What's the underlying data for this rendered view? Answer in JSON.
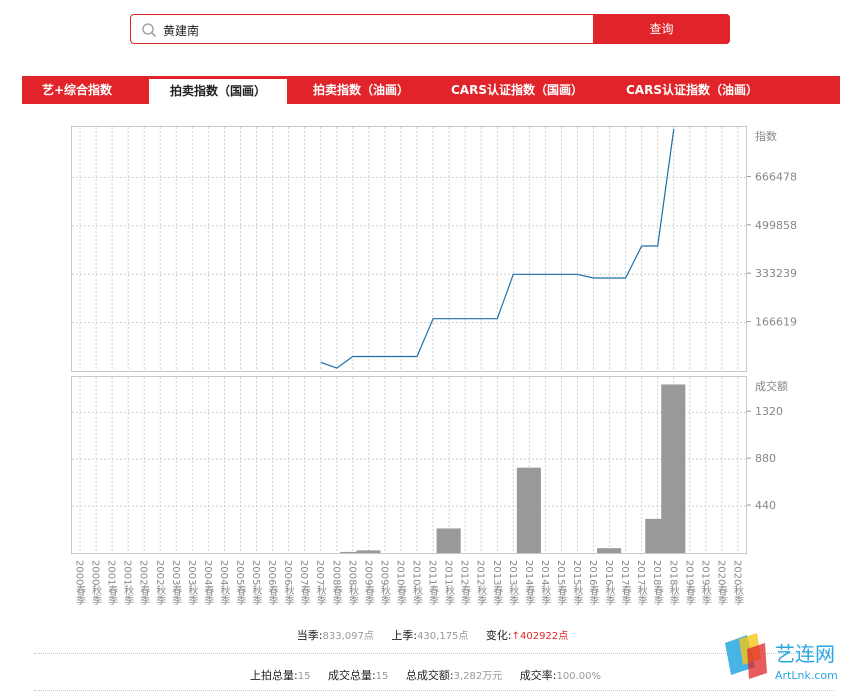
{
  "search": {
    "value": "黄建南",
    "button_label": "查询"
  },
  "tabs": [
    {
      "label": "艺+综合指数",
      "active": false
    },
    {
      "label": "拍卖指数（国画）",
      "active": true
    },
    {
      "label": "拍卖指数（油画）",
      "active": false
    },
    {
      "label": "CARS认证指数（国画）",
      "active": false
    },
    {
      "label": "CARS认证指数（油画）",
      "active": false
    }
  ],
  "chart_data": [
    {
      "type": "line",
      "ylabel": "指数",
      "yticks": [
        166619,
        333239,
        499858,
        666478
      ],
      "ylim": [
        0,
        840000
      ],
      "x": [
        "2000春季",
        "2000秋季",
        "2001秋季",
        "2002秋季",
        "2002春季",
        "2003春季",
        "2004春季",
        "2004秋季",
        "2005春季",
        "2006秋季",
        "2006春季",
        "2007秋季",
        "2008春季",
        "2008秋季",
        "2009秋季",
        "2009春季",
        "2010秋季",
        "2010春季",
        "2011秋季",
        "2012春季",
        "2012秋季",
        "2013春季",
        "2013秋季",
        "2014春季",
        "2015春季",
        "2015秋季",
        "2016秋季",
        "2017秋季",
        "2017春季",
        "2018秋季",
        "2018春季",
        "2019春季",
        "2019秋季",
        "2020春季",
        "2020秋季"
      ],
      "series": [
        {
          "color": "#1e6fa8",
          "values": [
            null,
            null,
            null,
            null,
            null,
            null,
            null,
            null,
            null,
            null,
            null,
            null,
            null,
            null,
            null,
            30000,
            10000,
            50000,
            50000,
            50000,
            50000,
            50000,
            180000,
            180000,
            180000,
            180000,
            180000,
            333000,
            333000,
            333000,
            333000,
            333000,
            320000,
            320000,
            320000,
            430175,
            430175,
            833097
          ]
        }
      ],
      "grid": true
    },
    {
      "type": "bar",
      "ylabel": "成交额",
      "yticks": [
        440,
        880,
        1320
      ],
      "ylim": [
        0,
        1650
      ],
      "series": [
        {
          "color": "#999999",
          "values": [
            0,
            0,
            0,
            0,
            0,
            0,
            0,
            0,
            0,
            0,
            0,
            0,
            0,
            0,
            0,
            0,
            0,
            10,
            25,
            0,
            0,
            0,
            0,
            230,
            0,
            0,
            0,
            0,
            800,
            0,
            0,
            0,
            0,
            45,
            0,
            0,
            320,
            1580
          ]
        }
      ],
      "grid": true
    }
  ],
  "x_labels": [
    "2000春季",
    "2000秋季",
    "2001春季",
    "2001秋季",
    "2002春季",
    "2002秋季",
    "2003春季",
    "2003秋季",
    "2004春季",
    "2004秋季",
    "2005春季",
    "2005秋季",
    "2006春季",
    "2006秋季",
    "2007春季",
    "2007秋季",
    "2008春季",
    "2008秋季",
    "2009春季",
    "2009秋季",
    "2010春季",
    "2010秋季",
    "2011春季",
    "2011秋季",
    "2012春季",
    "2012秋季",
    "2013春季",
    "2013秋季",
    "2014春季",
    "2014秋季",
    "2015春季",
    "2015秋季",
    "2016春季",
    "2016秋季",
    "2017春季",
    "2017秋季",
    "2018春季",
    "2018秋季",
    "2019春季",
    "2019秋季",
    "2020春季",
    "2020秋季"
  ],
  "stats": {
    "current_label": "当季:",
    "current_value": "833,097点",
    "last_label": "上季:",
    "last_value": "430,175点",
    "change_label": "变化:",
    "change_value": "402922点",
    "change_arrow": "↑",
    "lots_label": "上拍总量:",
    "lots_value": "15",
    "sold_label": "成交总量:",
    "sold_value": "15",
    "turnover_label": "总成交额:",
    "turnover_value": "3,282万元",
    "rate_label": "成交率:",
    "rate_value": "100.00%"
  },
  "brand": {
    "name": "艺连网",
    "url": "ArtLnk.com",
    "colors": [
      "#27a7e0",
      "#e0242a"
    ]
  },
  "colors": {
    "accent": "#e0242a",
    "line": "#1e6fa8",
    "bar": "#999999"
  }
}
